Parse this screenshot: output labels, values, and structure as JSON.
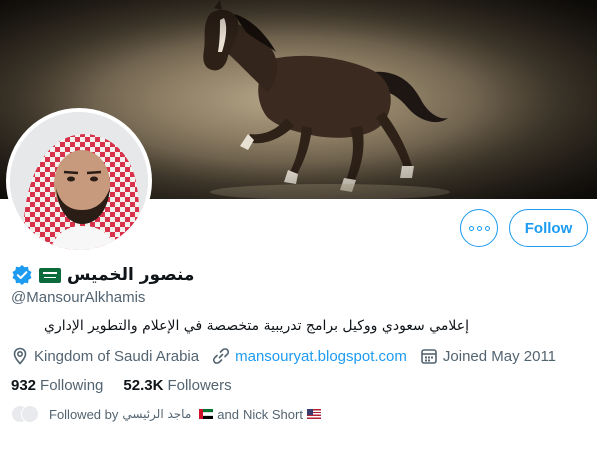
{
  "profile": {
    "display_name": "منصور الخميس",
    "handle": "@MansourAlkhamis",
    "bio": "إعلامي سعودي ووكيل برامج تدريبية متخصصة في الإعلام والتطوير الإداري",
    "verified": true,
    "country_flag": "saudi-arabia-flag"
  },
  "actions": {
    "more_label": "more-options",
    "follow_label": "Follow"
  },
  "meta": {
    "location": "Kingdom of Saudi Arabia",
    "website": "mansouryat.blogspot.com",
    "joined": "Joined May 2011"
  },
  "stats": {
    "following_count": "932",
    "following_label": "Following",
    "followers_count": "52.3K",
    "followers_label": "Followers"
  },
  "followed_by": {
    "prefix": "Followed by",
    "first_name": "ماجد الرئيسي",
    "first_flag": "uae-flag",
    "connector": "and",
    "second_name": "Nick Short",
    "second_flag": "us-flag"
  },
  "colors": {
    "accent": "#1d9bf0",
    "text_primary": "#0f1419",
    "text_secondary": "#536471"
  }
}
